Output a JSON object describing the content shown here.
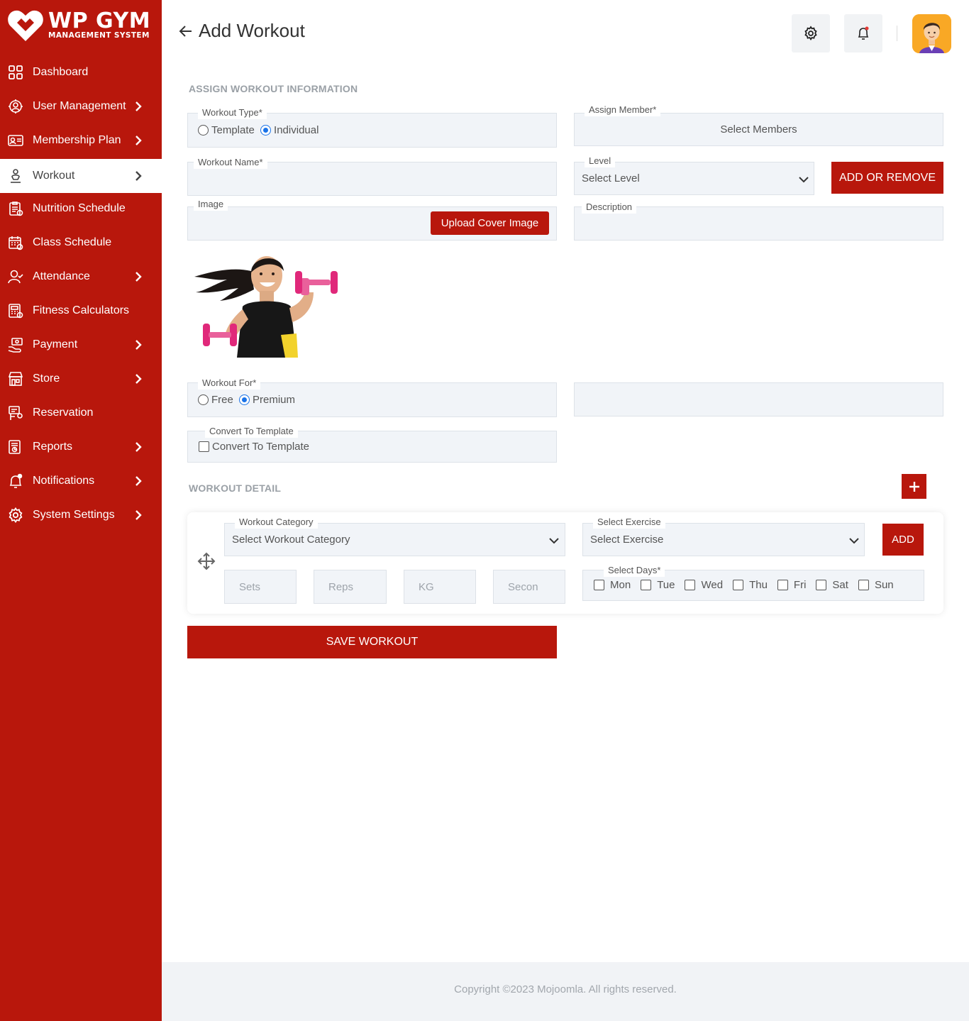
{
  "brand": {
    "title": "WP GYM",
    "subtitle": "MANAGEMENT SYSTEM"
  },
  "sidebar": {
    "items": [
      {
        "label": "Dashboard",
        "icon": "dashboard-grid-icon",
        "has_submenu": false,
        "active": false
      },
      {
        "label": "User Management",
        "icon": "users-gear-icon",
        "has_submenu": true,
        "active": false
      },
      {
        "label": "Membership Plan",
        "icon": "membership-card-icon",
        "has_submenu": true,
        "active": false
      },
      {
        "label": "Workout",
        "icon": "workout-icon",
        "has_submenu": true,
        "active": true
      },
      {
        "label": "Nutrition Schedule",
        "icon": "nutrition-clipboard-icon",
        "has_submenu": false,
        "active": false
      },
      {
        "label": "Class Schedule",
        "icon": "calendar-icon",
        "has_submenu": false,
        "active": false
      },
      {
        "label": "Attendance",
        "icon": "attendance-user-icon",
        "has_submenu": true,
        "active": false
      },
      {
        "label": "Fitness Calculators",
        "icon": "calculator-icon",
        "has_submenu": false,
        "active": false
      },
      {
        "label": "Payment",
        "icon": "payment-hand-icon",
        "has_submenu": true,
        "active": false
      },
      {
        "label": "Store",
        "icon": "store-icon",
        "has_submenu": true,
        "active": false
      },
      {
        "label": "Reservation",
        "icon": "reservation-icon",
        "has_submenu": false,
        "active": false
      },
      {
        "label": "Reports",
        "icon": "reports-icon",
        "has_submenu": true,
        "active": false
      },
      {
        "label": "Notifications",
        "icon": "bell-icon",
        "has_submenu": true,
        "active": false
      },
      {
        "label": "System Settings",
        "icon": "gear-icon",
        "has_submenu": true,
        "active": false
      }
    ]
  },
  "header": {
    "title": "Add Workout"
  },
  "assign": {
    "section_title": "ASSIGN WORKOUT INFORMATION",
    "workout_type": {
      "legend": "Workout Type*",
      "options": [
        "Template",
        "Individual"
      ],
      "selected": "Individual"
    },
    "assign_member": {
      "legend": "Assign Member*",
      "placeholder": "Select Members"
    },
    "workout_name": {
      "legend": "Workout Name*",
      "value": ""
    },
    "level": {
      "legend": "Level",
      "value": "Select Level"
    },
    "add_remove_label": "ADD OR REMOVE",
    "image": {
      "legend": "Image",
      "upload_label": "Upload Cover Image"
    },
    "description": {
      "legend": "Description",
      "value": ""
    },
    "workout_for": {
      "legend": "Workout For*",
      "options": [
        "Free",
        "Premium"
      ],
      "selected": "Premium"
    },
    "convert": {
      "legend": "Convert To Template",
      "label": "Convert To Template",
      "checked": false
    }
  },
  "detail": {
    "section_title": "WORKOUT DETAIL",
    "category": {
      "legend": "Workout Category",
      "value": "Select Workout Category"
    },
    "exercise": {
      "legend": "Select Exercise",
      "value": "Select Exercise"
    },
    "add_label": "ADD",
    "sets_placeholder": "Sets",
    "reps_placeholder": "Reps",
    "kg_placeholder": "KG",
    "seconds_placeholder": "Secon",
    "days": {
      "legend": "Select Days*",
      "items": [
        "Mon",
        "Tue",
        "Wed",
        "Thu",
        "Fri",
        "Sat",
        "Sun"
      ]
    }
  },
  "save_label": "SAVE WORKOUT",
  "footer": "Copyright ©2023 Mojoomla. All rights reserved.",
  "colors": {
    "primary": "#b8170c",
    "field_bg": "#f1f4f8",
    "radio_selected": "#1a73e8"
  }
}
